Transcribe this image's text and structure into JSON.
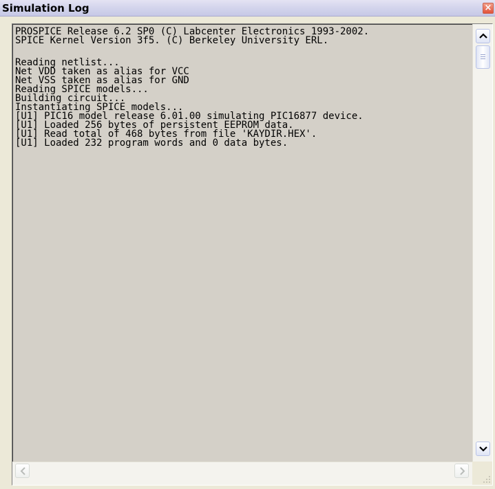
{
  "window": {
    "title": "Simulation Log",
    "close_icon": "close-icon",
    "accent_color": "#e2523a"
  },
  "log": {
    "lines": [
      "PROSPICE Release 6.2 SP0 (C) Labcenter Electronics 1993-2002.",
      "SPICE Kernel Version 3f5. (C) Berkeley University ERL.",
      "",
      "Reading netlist...",
      "Net VDD taken as alias for VCC",
      "Net VSS taken as alias for GND",
      "Reading SPICE models...",
      "Building circuit...",
      "Instantiating SPICE models...",
      "[U1] PIC16 model release 6.01.00 simulating PIC16877 device.",
      "[U1] Loaded 256 bytes of persistent EEPROM data.",
      "[U1] Read total of 468 bytes from file 'KAYDIR.HEX'.",
      "[U1] Loaded 232 program words and 0 data bytes."
    ]
  },
  "scrollbars": {
    "vertical_up_icon": "chevron-up-icon",
    "vertical_down_icon": "chevron-down-icon",
    "horizontal_left_icon": "chevron-left-icon",
    "horizontal_right_icon": "chevron-right-icon",
    "resize_icon": "resize-grip-icon"
  }
}
